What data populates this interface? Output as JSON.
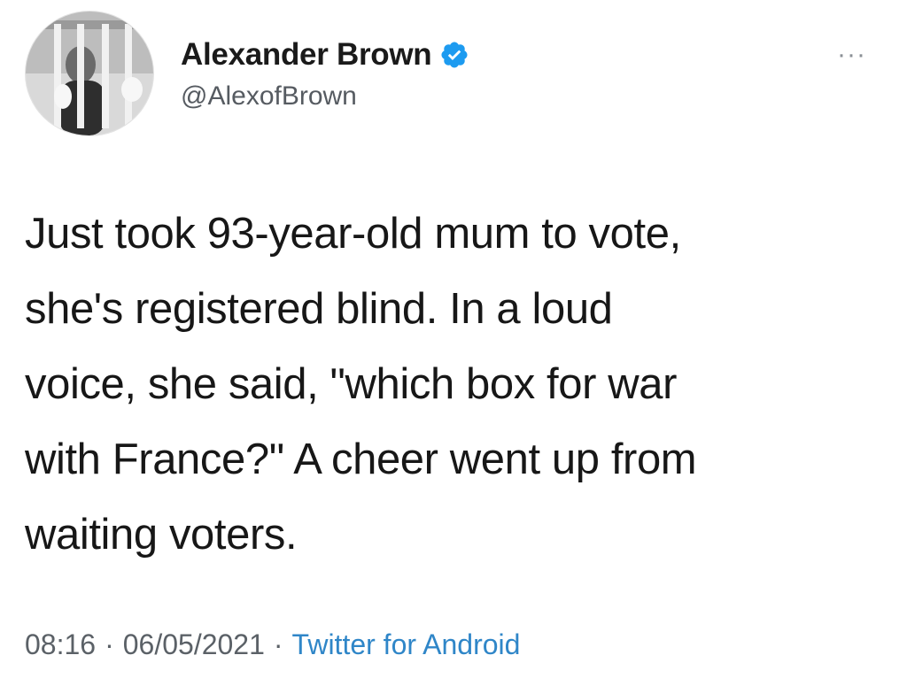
{
  "tweet": {
    "author": {
      "display_name": "Alexander Brown",
      "handle": "@AlexofBrown",
      "verified": true,
      "avatar_icon": "avatar-photo"
    },
    "more_icon": "more-horizontal-icon",
    "text": "Just took 93-year-old mum to vote,\nshe's registered blind. In a loud\nvoice, she said, \"which box for war\nwith France?\" A cheer went up from\nwaiting voters.",
    "meta": {
      "time": "08:16",
      "date": "06/05/2021",
      "source": "Twitter for Android",
      "separator": "·"
    },
    "colors": {
      "verified_blue": "#1d9bf0",
      "source_link": "#2f86c8"
    }
  }
}
